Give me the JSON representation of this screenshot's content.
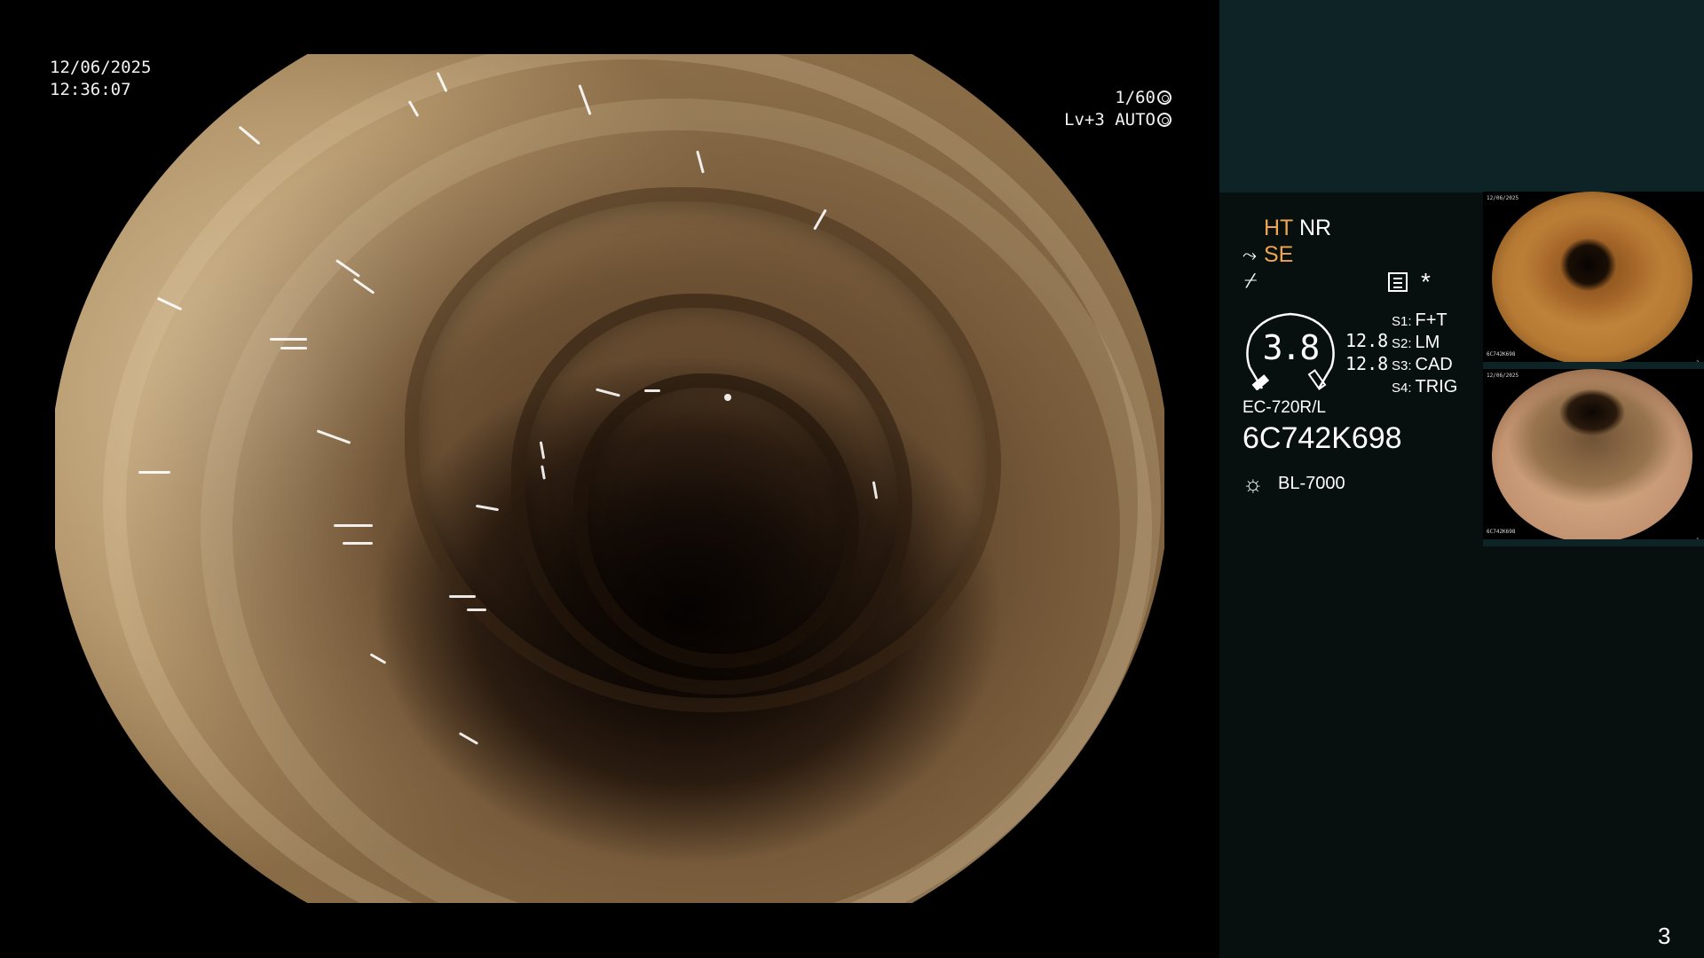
{
  "scope_overlay": {
    "date": "12/06/2025",
    "time": "12:36:07",
    "shutter": "1/60",
    "exposure": "Lv+3 AUTO"
  },
  "status_panel": {
    "enhance_ht": "HT",
    "enhance_nr": "NR",
    "enhance_se": "SE",
    "gauge_value": "3.8",
    "gauge_readout_1": "12.8",
    "gauge_readout_2": "12.8",
    "switches": [
      {
        "key": "S1:",
        "value": "F+T"
      },
      {
        "key": "S2:",
        "value": "LM"
      },
      {
        "key": "S3:",
        "value": "CAD"
      },
      {
        "key": "S4:",
        "value": "TRIG"
      }
    ],
    "scope_model": "EC-720R/L",
    "scope_serial": "6C742K698",
    "light_source": "BL-7000",
    "icons": [
      "se-mode-icon",
      "structure-mode-icon",
      "menu-icon",
      "star-icon",
      "lamp-icon"
    ],
    "accent_color": "#f0a64e",
    "header_color": "#0d2325"
  },
  "thumbnails": [
    {
      "date": "12/06/2025",
      "index": "2",
      "serial": "6C742K698"
    },
    {
      "date": "12/06/2025",
      "index": "1",
      "serial": "6C742K698"
    }
  ],
  "page_number": "3"
}
